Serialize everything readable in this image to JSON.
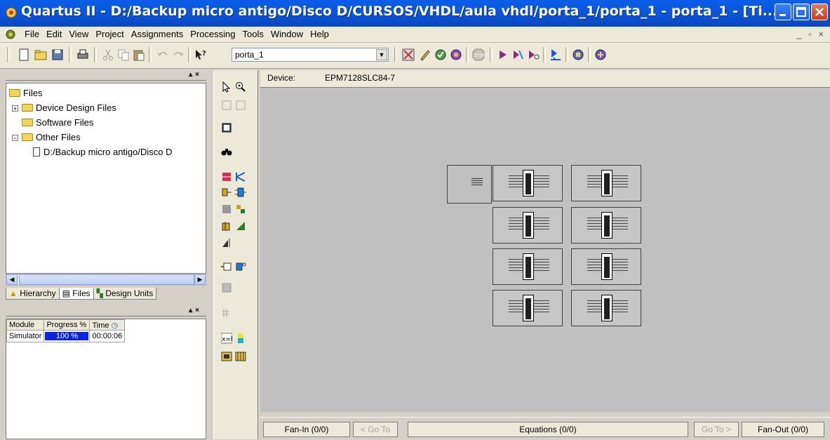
{
  "window": {
    "title": "Quartus II - D:/Backup micro antigo/Disco D/CURSOS/VHDL/aula vhdl/porta_1/porta_1 - porta_1 - [Ti...",
    "min_icon": "minimize-icon",
    "max_icon": "restore-icon",
    "close_icon": "close-icon"
  },
  "menu": [
    "File",
    "Edit",
    "View",
    "Project",
    "Assignments",
    "Processing",
    "Tools",
    "Window",
    "Help"
  ],
  "toolbar": {
    "project_combo_value": "porta_1"
  },
  "project_navigator": {
    "tree": [
      {
        "label": "Files",
        "level": 0
      },
      {
        "label": "Device Design Files",
        "level": 1
      },
      {
        "label": "Software Files",
        "level": 1
      },
      {
        "label": "Other Files",
        "level": 1
      },
      {
        "label": "D:/Backup micro antigo/Disco D",
        "level": 2
      }
    ],
    "tabs": [
      "Hierarchy",
      "Files",
      "Design Units"
    ]
  },
  "status": {
    "headers": [
      "Module",
      "Progress %",
      "Time"
    ],
    "rows": [
      {
        "module": "Simulator",
        "progress": "100 %",
        "time": "00:00:06",
        "progress_fraction": 1.0
      }
    ]
  },
  "floorplan": {
    "device_label": "Device:",
    "device_value": "EPM7128SLC84-7"
  },
  "bottom": {
    "fan_in": "Fan-In (0/0)",
    "goto_left": "< Go To",
    "equations": "Equations (0/0)",
    "goto_right": "Go To >",
    "fan_out": "Fan-Out (0/0)"
  },
  "colors": {
    "titlebar": "#0b52d6",
    "progress": "#0a24e6",
    "canvas": "#c0c0c0"
  }
}
